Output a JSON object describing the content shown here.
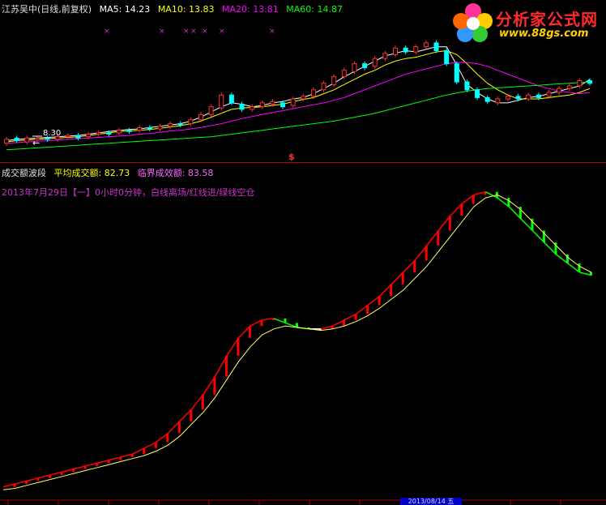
{
  "top_header": {
    "title": "江苏吴中(日线,前复权)",
    "ma5": "MA5: 14.23",
    "ma10": "MA10: 13.83",
    "ma20": "MA20: 13.81",
    "ma60": "MA60: 14.87"
  },
  "bottom_header": {
    "indicator": "成交额波段",
    "avg_label": "平均成交额: 82.73",
    "critical_label": "临界成效额: 83.58"
  },
  "info_line": "2013年7月29日【一】0小时0分钟，白线离场/红线进/绿线空仓",
  "price_marker": "8.30",
  "logo": {
    "main": "分析家公式网",
    "sub": "www.88gs.com"
  },
  "date_box": "2013/08/14 五",
  "colors": {
    "ma5": "#ffffff",
    "ma10": "#ffff00",
    "ma20": "#ff00ff",
    "ma60": "#00ff00",
    "up": "#ff3333",
    "down": "#00ffff",
    "upper_red": "#ff0000",
    "upper_green": "#00ff00",
    "upper_white": "#ffffff",
    "signal": "#ffff00"
  },
  "chart_data": [
    {
      "type": "candlestick",
      "title": "江苏吴中(日线,前复权)",
      "series": [
        {
          "name": "MA5",
          "values": [
            8.7,
            8.8,
            8.85,
            8.9,
            8.95,
            9.0,
            9.05,
            9.1,
            9.2,
            9.3,
            9.4,
            9.5,
            9.55,
            9.6,
            9.7,
            9.8,
            9.9,
            10.0,
            10.2,
            10.5,
            10.9,
            11.3,
            11.6,
            11.5,
            11.3,
            11.4,
            11.6,
            11.7,
            11.9,
            12.0,
            12.3,
            12.7,
            13.1,
            13.6,
            14.0,
            14.4,
            14.8,
            15.2,
            15.4,
            15.6,
            15.5,
            15.7,
            15.9,
            15.9,
            14.5,
            13.0,
            12.4,
            11.9,
            11.6,
            11.6,
            11.8,
            12.0,
            12.1,
            12.3,
            12.5,
            12.7,
            12.9,
            13.4
          ]
        },
        {
          "name": "MA10",
          "values": [
            8.6,
            8.7,
            8.75,
            8.8,
            8.85,
            8.9,
            8.95,
            9.0,
            9.1,
            9.2,
            9.3,
            9.4,
            9.45,
            9.5,
            9.55,
            9.65,
            9.75,
            9.85,
            10.0,
            10.2,
            10.5,
            10.8,
            11.1,
            11.2,
            11.25,
            11.3,
            11.4,
            11.5,
            11.7,
            11.85,
            12.0,
            12.3,
            12.6,
            13.0,
            13.4,
            13.8,
            14.1,
            14.5,
            14.8,
            15.0,
            15.1,
            15.3,
            15.5,
            15.6,
            15.3,
            14.6,
            13.8,
            13.1,
            12.6,
            12.2,
            11.9,
            11.9,
            11.9,
            12.0,
            12.1,
            12.2,
            12.4,
            12.7
          ]
        },
        {
          "name": "MA20",
          "values": [
            8.5,
            8.55,
            8.6,
            8.65,
            8.7,
            8.75,
            8.8,
            8.85,
            8.9,
            8.95,
            9.0,
            9.05,
            9.1,
            9.2,
            9.25,
            9.35,
            9.45,
            9.5,
            9.6,
            9.7,
            9.85,
            10.0,
            10.2,
            10.4,
            10.55,
            10.7,
            10.85,
            11.0,
            11.15,
            11.3,
            11.45,
            11.6,
            11.8,
            12.0,
            12.3,
            12.6,
            12.9,
            13.2,
            13.5,
            13.8,
            14.0,
            14.2,
            14.4,
            14.6,
            14.7,
            14.7,
            14.6,
            14.4,
            14.1,
            13.8,
            13.5,
            13.2,
            12.9,
            12.7,
            12.5,
            12.4,
            12.3,
            12.4
          ]
        },
        {
          "name": "MA60",
          "values": [
            8.0,
            8.05,
            8.1,
            8.15,
            8.2,
            8.25,
            8.3,
            8.35,
            8.4,
            8.45,
            8.5,
            8.55,
            8.6,
            8.65,
            8.7,
            8.75,
            8.8,
            8.85,
            8.9,
            8.95,
            9.0,
            9.1,
            9.2,
            9.3,
            9.4,
            9.5,
            9.6,
            9.7,
            9.8,
            9.9,
            10.0,
            10.1,
            10.2,
            10.35,
            10.5,
            10.65,
            10.8,
            11.0,
            11.2,
            11.4,
            11.6,
            11.8,
            12.0,
            12.2,
            12.35,
            12.5,
            12.6,
            12.7,
            12.75,
            12.8,
            12.85,
            12.9,
            12.95,
            13.0,
            13.05,
            13.1,
            13.15,
            13.2
          ]
        }
      ],
      "candles": [
        {
          "o": 8.5,
          "c": 8.8
        },
        {
          "o": 8.9,
          "c": 8.7
        },
        {
          "o": 8.6,
          "c": 8.9
        },
        {
          "o": 8.8,
          "c": 8.9
        },
        {
          "o": 8.9,
          "c": 8.8
        },
        {
          "o": 8.8,
          "c": 9.0
        },
        {
          "o": 9.0,
          "c": 9.1
        },
        {
          "o": 9.1,
          "c": 8.9
        },
        {
          "o": 9.0,
          "c": 9.2
        },
        {
          "o": 9.2,
          "c": 9.3
        },
        {
          "o": 9.3,
          "c": 9.2
        },
        {
          "o": 9.3,
          "c": 9.5
        },
        {
          "o": 9.5,
          "c": 9.4
        },
        {
          "o": 9.5,
          "c": 9.7
        },
        {
          "o": 9.7,
          "c": 9.6
        },
        {
          "o": 9.6,
          "c": 9.8
        },
        {
          "o": 9.8,
          "c": 10.0
        },
        {
          "o": 10.0,
          "c": 9.9
        },
        {
          "o": 10.0,
          "c": 10.3
        },
        {
          "o": 10.3,
          "c": 10.7
        },
        {
          "o": 10.7,
          "c": 11.3
        },
        {
          "o": 11.2,
          "c": 12.2
        },
        {
          "o": 12.2,
          "c": 11.6
        },
        {
          "o": 11.5,
          "c": 11.1
        },
        {
          "o": 11.1,
          "c": 11.3
        },
        {
          "o": 11.3,
          "c": 11.6
        },
        {
          "o": 11.5,
          "c": 11.7
        },
        {
          "o": 11.6,
          "c": 11.3
        },
        {
          "o": 11.4,
          "c": 11.9
        },
        {
          "o": 11.9,
          "c": 12.1
        },
        {
          "o": 12.1,
          "c": 12.6
        },
        {
          "o": 12.6,
          "c": 13.1
        },
        {
          "o": 13.0,
          "c": 13.6
        },
        {
          "o": 13.6,
          "c": 14.1
        },
        {
          "o": 14.0,
          "c": 14.6
        },
        {
          "o": 14.6,
          "c": 14.3
        },
        {
          "o": 14.4,
          "c": 15.0
        },
        {
          "o": 15.0,
          "c": 15.4
        },
        {
          "o": 15.3,
          "c": 15.8
        },
        {
          "o": 15.8,
          "c": 15.5
        },
        {
          "o": 15.5,
          "c": 15.9
        },
        {
          "o": 15.9,
          "c": 16.2
        },
        {
          "o": 16.2,
          "c": 15.6
        },
        {
          "o": 15.6,
          "c": 14.6
        },
        {
          "o": 14.6,
          "c": 13.2
        },
        {
          "o": 13.2,
          "c": 12.6
        },
        {
          "o": 12.6,
          "c": 12.0
        },
        {
          "o": 12.0,
          "c": 11.7
        },
        {
          "o": 11.6,
          "c": 11.9
        },
        {
          "o": 11.9,
          "c": 12.1
        },
        {
          "o": 12.1,
          "c": 11.9
        },
        {
          "o": 11.9,
          "c": 12.2
        },
        {
          "o": 12.2,
          "c": 12.0
        },
        {
          "o": 12.1,
          "c": 12.4
        },
        {
          "o": 12.4,
          "c": 12.7
        },
        {
          "o": 12.7,
          "c": 12.9
        },
        {
          "o": 12.9,
          "c": 13.3
        },
        {
          "o": 13.3,
          "c": 13.1
        }
      ],
      "ylim": [
        7.8,
        17.0
      ]
    },
    {
      "type": "bar",
      "title": "成交额波段",
      "series": [
        {
          "name": "成交额",
          "values": [
            2,
            3,
            4,
            5,
            6,
            7,
            8,
            9,
            10,
            11,
            12,
            13,
            15,
            17,
            20,
            24,
            28,
            33,
            39,
            46,
            52,
            56,
            58,
            58.5,
            57,
            55.5,
            55,
            55,
            56,
            58,
            60,
            63,
            66,
            70,
            74,
            78,
            83,
            88,
            93,
            97,
            100,
            101,
            99,
            96,
            92,
            88,
            84,
            80,
            77,
            74,
            73
          ]
        },
        {
          "name": "均线",
          "values": [
            1,
            1.5,
            2.5,
            3.5,
            4.5,
            5.5,
            6.5,
            7.5,
            8.5,
            9.5,
            10.5,
            11.5,
            12.5,
            14,
            16,
            19,
            23,
            27,
            32,
            38,
            44,
            49,
            53,
            55,
            56,
            55.5,
            55,
            54.5,
            55,
            56,
            57.5,
            59.5,
            62,
            65,
            68,
            72,
            76,
            81,
            86,
            91,
            96,
            99,
            100,
            98,
            95,
            91,
            87,
            83,
            79,
            76,
            74
          ]
        }
      ],
      "ylim": [
        0,
        105
      ]
    }
  ]
}
